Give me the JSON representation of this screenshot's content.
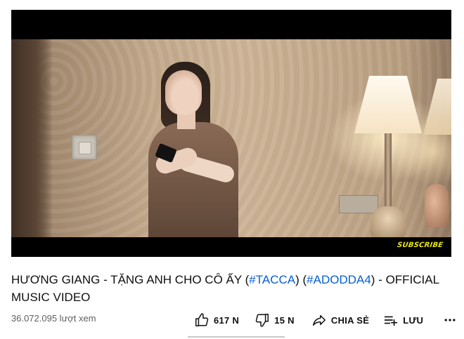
{
  "video": {
    "overlay_text": "SUBSCRIBE"
  },
  "title": {
    "part1": "HƯƠNG GIANG - TẶNG ANH CHO CÔ ẤY (",
    "hashtag1": "#TACCA",
    "part2": ") (",
    "hashtag2": "#ADODDA4",
    "part3": ") - OFFICIAL MUSIC VIDEO"
  },
  "meta": {
    "views": "36.072.095 lượt xem"
  },
  "actions": {
    "like_count": "617 N",
    "dislike_count": "15 N",
    "share_label": "CHIA SẺ",
    "save_label": "LƯU"
  },
  "icons": {
    "like": "thumbs-up-icon",
    "dislike": "thumbs-down-icon",
    "share": "share-arrow-icon",
    "save": "playlist-add-icon",
    "more": "more-horizontal-icon"
  },
  "colors": {
    "hashtag": "#065fd4",
    "secondary_text": "#606060",
    "subscribe_badge": "#e7e210"
  }
}
